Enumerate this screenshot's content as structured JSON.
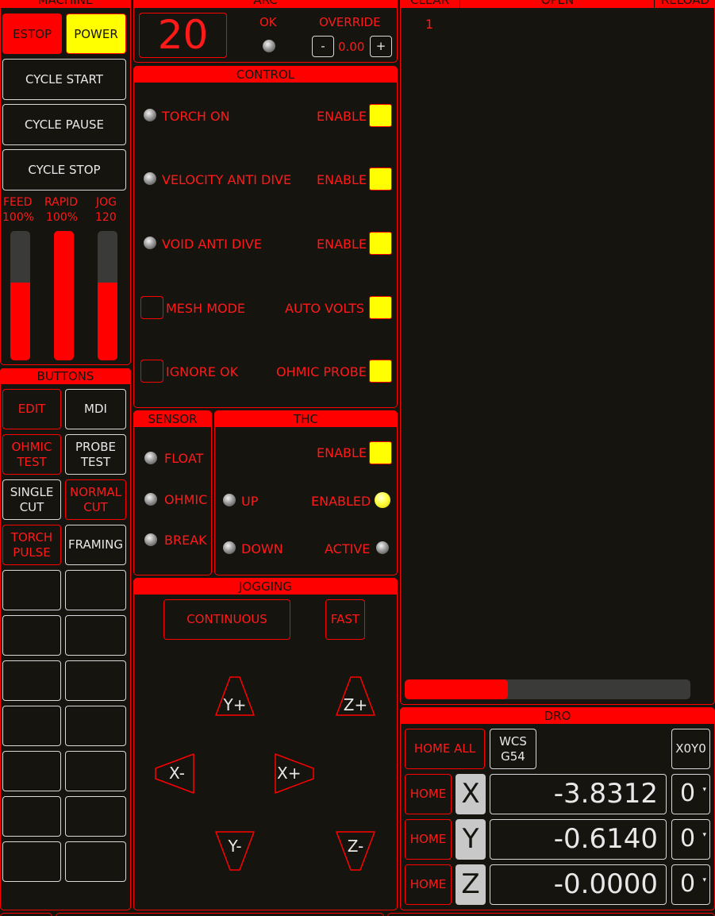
{
  "machine": {
    "header": "MACHINE",
    "estop": "ESTOP",
    "power": "POWER",
    "cycle_start": "CYCLE START",
    "cycle_pause": "CYCLE PAUSE",
    "cycle_stop": "CYCLE STOP",
    "feed_label": "FEED",
    "feed_value": "100%",
    "rapid_label": "RAPID",
    "rapid_value": "100%",
    "jog_label": "JOG",
    "jog_value": "120",
    "feed_fraction": 0.6,
    "rapid_fraction": 1.0,
    "jog_fraction": 0.6
  },
  "arc": {
    "header": "ARC",
    "voltage": "20",
    "ok_label": "OK",
    "override_label": "OVERRIDE",
    "minus": "-",
    "override_value": "0.00",
    "plus": "+"
  },
  "control": {
    "header": "CONTROL",
    "torch_on": "TORCH ON",
    "velocity_anti_dive": "VELOCITY ANTI DIVE",
    "void_anti_dive": "VOID ANTI DIVE",
    "mesh_mode": "MESH MODE",
    "ignore_ok": "IGNORE OK",
    "enable": "ENABLE",
    "auto_volts": "AUTO VOLTS",
    "ohmic_probe": "OHMIC PROBE"
  },
  "sensor": {
    "header": "SENSOR",
    "float": "FLOAT",
    "ohmic": "OHMIC",
    "break": "BREAK"
  },
  "thc": {
    "header": "THC",
    "enable": "ENABLE",
    "up": "UP",
    "enabled": "ENABLED",
    "down": "DOWN",
    "active": "ACTIVE"
  },
  "jogging": {
    "header": "JOGGING",
    "continuous": "CONTINUOUS",
    "fast": "FAST",
    "y_plus": "Y+",
    "z_plus": "Z+",
    "x_minus": "X-",
    "x_plus": "X+",
    "y_minus": "Y-",
    "z_minus": "Z-"
  },
  "buttons": {
    "header": "BUTTONS",
    "edit": "EDIT",
    "mdi": "MDI",
    "ohmic_test_1": "OHMIC",
    "ohmic_test_2": "TEST",
    "probe_test_1": "PROBE",
    "probe_test_2": "TEST",
    "single_cut_1": "SINGLE",
    "single_cut_2": "CUT",
    "normal_cut_1": "NORMAL",
    "normal_cut_2": "CUT",
    "torch_pulse_1": "TORCH",
    "torch_pulse_2": "PULSE",
    "framing": "FRAMING"
  },
  "gcode": {
    "clear": "CLEAR",
    "open": "OPEN",
    "reload": "RELOAD",
    "line_number": "1",
    "progress_fraction": 0.36
  },
  "dro": {
    "header": "DRO",
    "home_all": "HOME ALL",
    "wcs_1": "WCS",
    "wcs_2": "G54",
    "x0y0": "X0Y0",
    "home": "HOME",
    "x_axis": "X",
    "y_axis": "Y",
    "z_axis": "Z",
    "x_value": "-3.8312",
    "y_value": "-0.6140",
    "z_value": "-0.0000",
    "x_unit": "0",
    "y_unit": "0",
    "z_unit": "0"
  },
  "colors": {
    "accent": "#ff0000",
    "background": "#16140f",
    "highlight": "#ffff00"
  }
}
